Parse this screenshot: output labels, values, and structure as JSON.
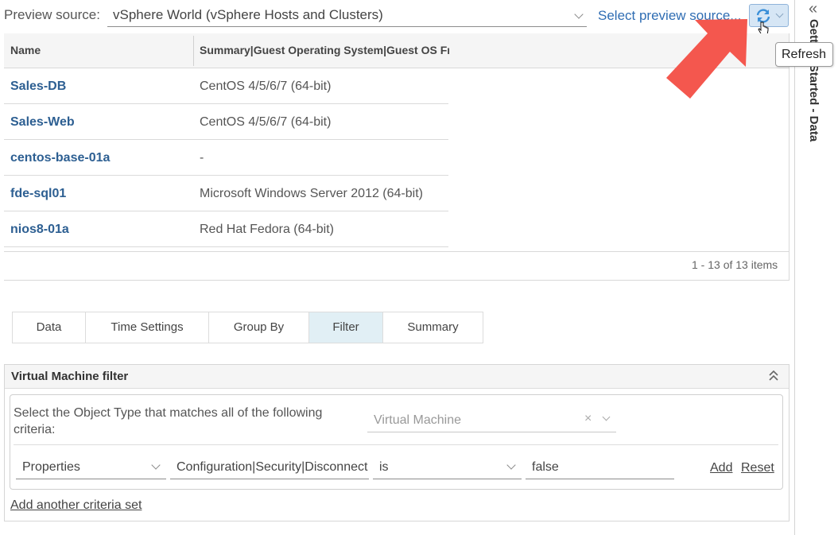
{
  "preview": {
    "label": "Preview source:",
    "source_value": "vSphere World (vSphere Hosts and Clusters)",
    "select_link": "Select preview source...",
    "refresh_tooltip": "Refresh"
  },
  "sidebar": {
    "collapse_glyph": "«",
    "title": "Getting Started - Data"
  },
  "grid": {
    "columns": [
      "Name",
      "Summary|Guest Operating System|Guest OS From Tools"
    ],
    "rows": [
      {
        "name": "Sales-DB",
        "os": "CentOS 4/5/6/7 (64-bit)"
      },
      {
        "name": "Sales-Web",
        "os": "CentOS 4/5/6/7 (64-bit)"
      },
      {
        "name": "centos-base-01a",
        "os": "-"
      },
      {
        "name": "fde-sql01",
        "os": "Microsoft Windows Server 2012 (64-bit)"
      },
      {
        "name": "nios8-01a",
        "os": "Red Hat Fedora (64-bit)"
      }
    ],
    "pager": "1 - 13 of 13 items"
  },
  "tabs": [
    {
      "label": "Data",
      "active": false
    },
    {
      "label": "Time Settings",
      "active": false
    },
    {
      "label": "Group By",
      "active": false
    },
    {
      "label": "Filter",
      "active": true
    },
    {
      "label": "Summary",
      "active": false
    }
  ],
  "filter": {
    "title": "Virtual Machine filter",
    "criteria_label": "Select the Object Type that matches all of the following criteria:",
    "object_type_value": "Virtual Machine",
    "clear_glyph": "×",
    "criterion": {
      "type": "Properties",
      "metric": "Configuration|Security|Disconnect",
      "operator": "is",
      "value": "false"
    },
    "add_label": "Add",
    "reset_label": "Reset",
    "add_criteria_set": "Add another criteria set"
  },
  "colors": {
    "link": "#2f6db3",
    "row_name": "#2d5f92",
    "active_tab": "#e1eff5",
    "annotation_arrow": "#f4574e"
  }
}
